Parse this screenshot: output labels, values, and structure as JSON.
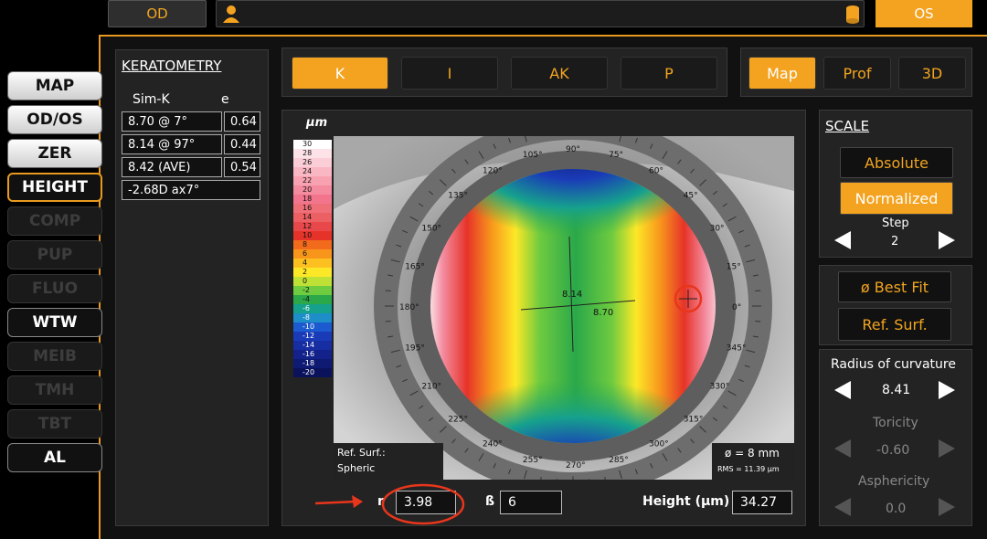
{
  "topbar": {
    "od_label": "OD",
    "os_label": "OS"
  },
  "sidebar": {
    "items": [
      {
        "label": "MAP",
        "state": "normal"
      },
      {
        "label": "OD/OS",
        "state": "normal"
      },
      {
        "label": "ZER",
        "state": "normal"
      },
      {
        "label": "HEIGHT",
        "state": "active"
      },
      {
        "label": "COMP",
        "state": "disabled"
      },
      {
        "label": "PUP",
        "state": "disabled"
      },
      {
        "label": "FLUO",
        "state": "disabled"
      },
      {
        "label": "WTW",
        "state": "normal"
      },
      {
        "label": "MEIB",
        "state": "disabled"
      },
      {
        "label": "TMH",
        "state": "disabled"
      },
      {
        "label": "TBT",
        "state": "disabled"
      },
      {
        "label": "AL",
        "state": "normal"
      }
    ]
  },
  "keratometry": {
    "title": "KERATOMETRY",
    "col_simk": "Sim-K",
    "col_e": "e",
    "rows": [
      {
        "value": "8.70  @ 7°",
        "e": "0.64"
      },
      {
        "value": "8.14  @ 97°",
        "e": "0.44"
      },
      {
        "value": "8.42 (AVE)",
        "e": "0.54"
      },
      {
        "value": "-2.68D ax7°",
        "e": ""
      }
    ]
  },
  "map_tabs": [
    "K",
    "I",
    "AK",
    "P"
  ],
  "view_tabs": [
    "Map",
    "Prof",
    "3D"
  ],
  "map": {
    "unit": "µm",
    "legend": [
      "30",
      "28",
      "26",
      "24",
      "22",
      "20",
      "18",
      "16",
      "14",
      "12",
      "10",
      "8",
      "6",
      "4",
      "2",
      "0",
      "-2",
      "-4",
      "-6",
      "-8",
      "-10",
      "-12",
      "-14",
      "-16",
      "-18",
      "-20"
    ],
    "legend_colors": [
      "#ffffff",
      "#fde3e8",
      "#fbcdd6",
      "#f9b7c3",
      "#f7a1b1",
      "#f48b9f",
      "#f2758d",
      "#ef6f79",
      "#ec5f62",
      "#e8484a",
      "#e63329",
      "#f26b1c",
      "#f8961c",
      "#fcc120",
      "#fde827",
      "#bfe034",
      "#6fcb3f",
      "#2aa84a",
      "#16a18d",
      "#1e8ec8",
      "#1b5bcf",
      "#1a3bb8",
      "#172da2",
      "#13228a",
      "#0f1a73",
      "#0b125c"
    ],
    "angles": [
      "105°",
      "90°",
      "75°",
      "120°",
      "60°",
      "135°",
      "45°",
      "150°",
      "30°",
      "165°",
      "15°",
      "180°",
      "0°",
      "195°",
      "345°",
      "210°",
      "330°",
      "225°",
      "315°",
      "240°",
      "300°",
      "255°",
      "270°",
      "285°"
    ],
    "center_vals": {
      "v1": "8.14",
      "v2": "8.70"
    },
    "ref_label": "Ref. Surf.:",
    "ref_value": "Spheric",
    "diameter": "ø = 8 mm",
    "rms": "RMS = 11.39 µm"
  },
  "bottom": {
    "r_label": "r",
    "r_value": "3.98",
    "b_label": "ß",
    "b_value": "6",
    "height_label": "Height (µm)",
    "height_value": "34.27"
  },
  "scale": {
    "title": "SCALE",
    "absolute": "Absolute",
    "normalized": "Normalized",
    "step_label": "Step",
    "step_value": "2"
  },
  "buttons": {
    "best_fit": "ø Best Fit",
    "ref_surf": "Ref. Surf."
  },
  "radius": {
    "title": "Radius of curvature",
    "value": "8.41",
    "toricity_label": "Toricity",
    "toricity_value": "-0.60",
    "asphericity_label": "Asphericity",
    "asphericity_value": "0.0"
  },
  "colors": {
    "accent": "#f3a31f",
    "annotation": "#e8361c"
  }
}
